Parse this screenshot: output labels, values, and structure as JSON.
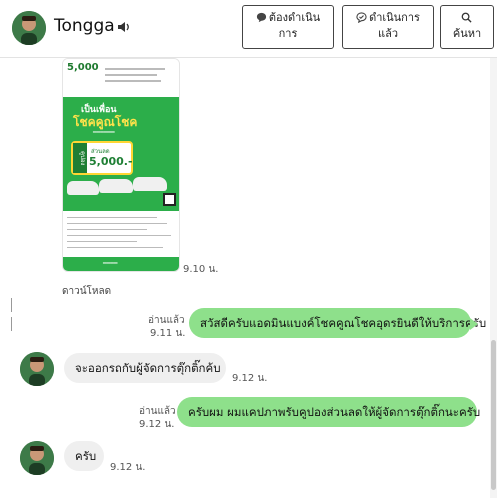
{
  "header": {
    "contact_name": "Tongga",
    "buttons": [
      {
        "label_line1": "ต้องดำเนิน",
        "label_line2": "การ"
      },
      {
        "label_line1": "ดำเนินการ",
        "label_line2": "แล้ว"
      },
      {
        "label_line1": "",
        "label_line2": "ค้นหา"
      }
    ]
  },
  "flyer": {
    "amount": "5,000",
    "headline1": "เป็นเพื่อน",
    "headline2": "โชคคูณโชค",
    "coupon_vertical": "คูปอง",
    "coupon_label": "ส่วนลด",
    "coupon_amount": "5,000.-"
  },
  "messages": [
    {
      "id": "flyer",
      "time": "9.10 น.",
      "download_label": "ดาวน์โหลด"
    },
    {
      "id": "m1",
      "direction": "out",
      "read": "อ่านแล้ว",
      "time": "9.11 น.",
      "text": "สวัสดีครับแอดมินแบงค์โชคคูณโชคอุดรยินดีให้บริการครับ"
    },
    {
      "id": "m2",
      "direction": "in",
      "time": "9.12 น.",
      "text": "จะออกรถกับผู้จัดการตุ๊กติ๊กค้บ"
    },
    {
      "id": "m3",
      "direction": "out",
      "read": "อ่านแล้ว",
      "time": "9.12 น.",
      "text": "ครับผม ผมแคปภาพรับคูปองส่วนลดให้ผู้จัดการตุ๊กติ๊กนะครับ"
    },
    {
      "id": "m4",
      "direction": "in",
      "time": "9.12 น.",
      "text": "ครับ"
    }
  ]
}
